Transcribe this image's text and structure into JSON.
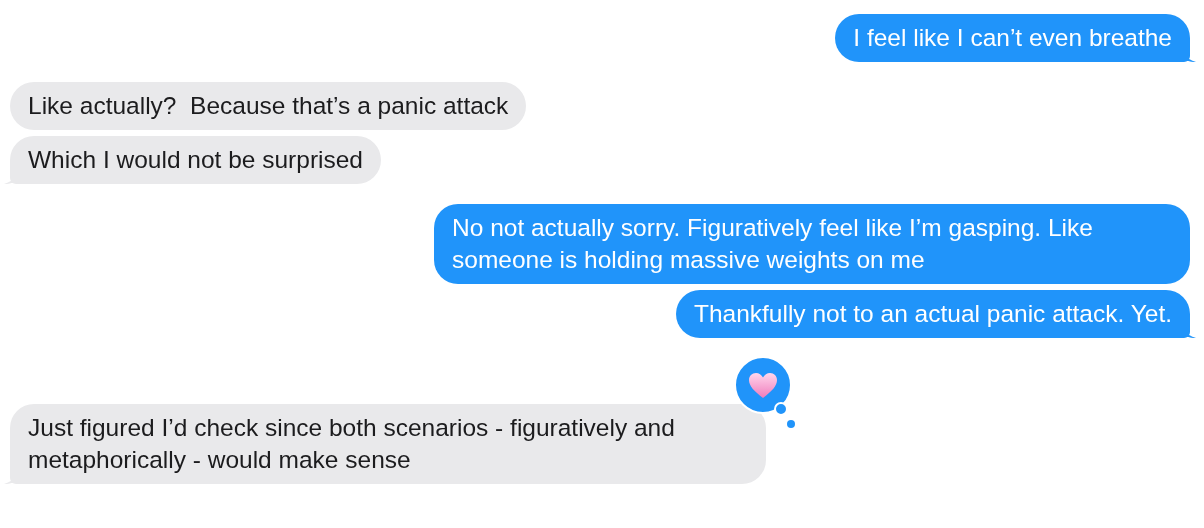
{
  "messages": [
    {
      "kind": "sent",
      "text": "I feel like I can’t even breathe",
      "tail": true
    },
    {
      "kind": "received",
      "text": "Like actually?  Because that’s a panic attack",
      "tail": false
    },
    {
      "kind": "received",
      "text": "Which I would not be surprised",
      "tail": true
    },
    {
      "kind": "sent",
      "text": "No not actually sorry. Figuratively feel like I’m gasping. Like someone is holding massive weights on me",
      "tail": false
    },
    {
      "kind": "sent",
      "text": "Thankfully not to an actual panic attack. Yet.",
      "tail": true
    },
    {
      "kind": "received",
      "text": "Just figured I’d check since both scenarios - figuratively and metaphorically - would make sense",
      "tail": true,
      "hearted": true
    }
  ]
}
